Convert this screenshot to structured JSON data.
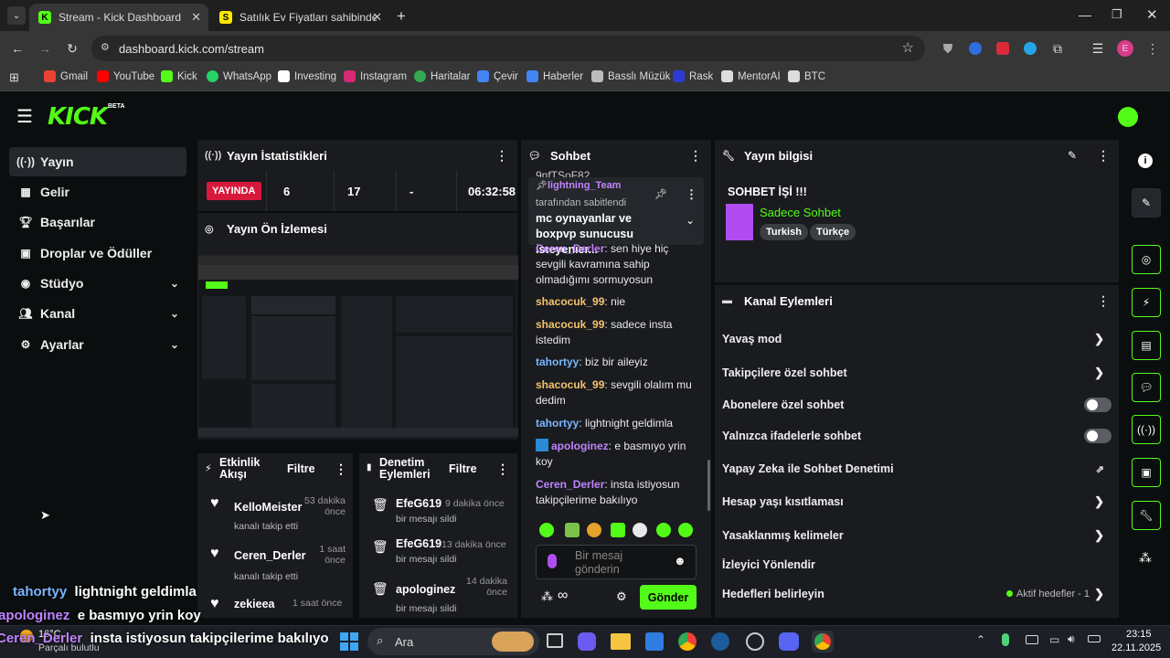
{
  "browser": {
    "tabs": [
      {
        "label": "Stream - Kick Dashboard",
        "favicon": "K",
        "active": true
      },
      {
        "label": "Satılık Ev Fiyatları sahibinden.co",
        "favicon": "S",
        "active": false
      }
    ],
    "url": "dashboard.kick.com/stream",
    "profile_initial": "E",
    "bookmarks": [
      "Gmail",
      "YouTube",
      "Kick",
      "WhatsApp",
      "Investing",
      "Instagram",
      "Haritalar",
      "Çevir",
      "Haberler",
      "Basslı Müzük",
      "Rask",
      "MentorAI",
      "BTC"
    ]
  },
  "kick": {
    "logo": "KICK",
    "logo_badge": "BETA",
    "sidebar": [
      {
        "label": "Yayın",
        "icon": "broadcast-icon"
      },
      {
        "label": "Gelir",
        "icon": "chart-icon"
      },
      {
        "label": "Başarılar",
        "icon": "trophy-icon"
      },
      {
        "label": "Droplar ve Ödüller",
        "icon": "gift-icon"
      },
      {
        "label": "Stüdyo",
        "icon": "studio-icon",
        "chevron": "⌄"
      },
      {
        "label": "Kanal",
        "icon": "people-icon",
        "chevron": "⌄"
      },
      {
        "label": "Ayarlar",
        "icon": "gear-icon",
        "chevron": "⌄"
      }
    ],
    "stats": {
      "title": "Yayın İstatistikleri",
      "live": "YAYINDA",
      "viewers": "6",
      "followers": "17",
      "dash": "-",
      "uptime": "06:32:58"
    },
    "preview": {
      "title": "Yayın Ön İzlemesi"
    },
    "activity": {
      "title": "Etkinlik Akışı",
      "filter": "Filtre",
      "items": [
        {
          "user": "KelloMeister",
          "time": "53 dakika önce",
          "action": "kanalı takip etti"
        },
        {
          "user": "Ceren_Derler",
          "time": "1 saat önce",
          "action": "kanalı takip etti"
        },
        {
          "user": "zekieea",
          "time": "1 saat önce",
          "action": ""
        }
      ]
    },
    "moderation": {
      "title": "Denetim Eylemleri",
      "filter": "Filtre",
      "items": [
        {
          "user": "EfeG619",
          "time": "9 dakika önce",
          "action": "bir mesajı sildi"
        },
        {
          "user": "EfeG619",
          "time": "13 dakika önce",
          "action": "bir mesajı sildi"
        },
        {
          "user": "apologinez",
          "time": "14 dakika önce",
          "action": "bir mesajı sildi"
        }
      ]
    },
    "chat": {
      "title": "Sohbet",
      "partial_top": "9nfTSoF82",
      "pinned": {
        "user": "lightning_Team",
        "by": "tarafından sabitlendi",
        "text": "mc oynayanlar ve boxpvp sunucusu isteyenler..."
      },
      "messages": [
        {
          "user": "Ceren_Derler",
          "text": "sen hiye hiç sevgili kavramına sahip olmadığımı sormuyosun",
          "color": "#c084fc"
        },
        {
          "user": "shacocuk_99",
          "text": "nie",
          "color": "#f5c26b"
        },
        {
          "user": "shacocuk_99",
          "text": "sadece insta istedim",
          "color": "#f5c26b"
        },
        {
          "user": "tahortyy",
          "text": "biz bir aileyiz",
          "color": "#7ab7ff"
        },
        {
          "user": "shacocuk_99",
          "text": "sevgili olalım mu dedim",
          "color": "#f5c26b"
        },
        {
          "user": "tahortyy",
          "text": "lightnight geldimla",
          "color": "#7ab7ff"
        },
        {
          "user": "apologinez",
          "text": "e basmıyo yrin koy",
          "color": "#c084fc"
        },
        {
          "user": "Ceren_Derler",
          "text": "insta istiyosun takipçilerime bakılıyo",
          "color": "#c084fc"
        }
      ],
      "placeholder": "Bir mesaj gönderin",
      "send": "Gönder"
    },
    "stream_info": {
      "title": "Yayın bilgisi",
      "stream_title": "SOHBET İŞİ !!!",
      "category": "Sadece Sohbet",
      "tags": [
        "Turkish",
        "Türkçe"
      ]
    },
    "channel_actions": {
      "title": "Kanal Eylemleri",
      "items": [
        {
          "label": "Yavaş mod",
          "type": "arrow"
        },
        {
          "label": "Takipçilere özel sohbet",
          "type": "arrow"
        },
        {
          "label": "Abonelere özel sohbet",
          "type": "toggle"
        },
        {
          "label": "Yalnızca ifadelerle sohbet",
          "type": "toggle"
        },
        {
          "label": "Yapay Zeka ile Sohbet Denetimi",
          "type": "external"
        },
        {
          "label": "Hesap yaşı kısıtlaması",
          "type": "arrow"
        },
        {
          "label": "Yasaklanmış kelimeler",
          "type": "arrow"
        },
        {
          "label": "İzleyici Yönlendir",
          "type": "none"
        },
        {
          "label": "Hedefleri belirleyin",
          "type": "goal",
          "extra": "Aktif hedefler - 1"
        }
      ]
    }
  },
  "overlay": [
    {
      "user": "tahortyy",
      "text": "lightnight geldimla"
    },
    {
      "user": "apologinez",
      "text": "e basmıyo yrin koy"
    },
    {
      "user": "Ceren_Derler",
      "text": "insta istiyosun takipçilerime bakılıyo"
    }
  ],
  "taskbar": {
    "weather": "16°C",
    "weather_sub": "Parçalı bulutlu",
    "search": "Ara",
    "time": "23:15",
    "date": "22.11.2025"
  }
}
